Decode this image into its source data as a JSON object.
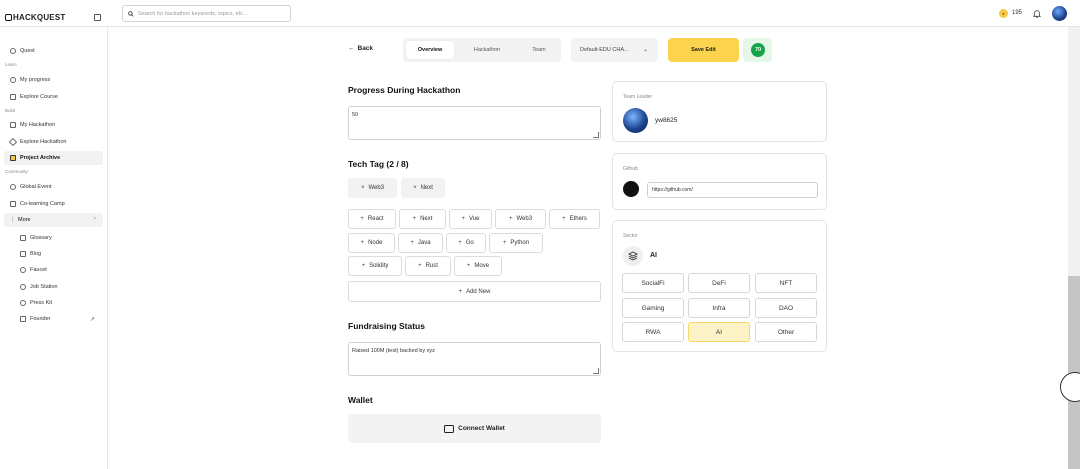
{
  "header": {
    "logo": "HACKQUEST",
    "search_placeholder": "Search for hackathon keywords, topics, etc...",
    "coins": "195"
  },
  "sidebar": {
    "quest": "Quest",
    "sections": {
      "learn": "Learn",
      "build": "Build",
      "community": "Community"
    },
    "learn_items": [
      "My progress",
      "Explore Course"
    ],
    "build_items": [
      "My Hackathon",
      "Explore Hackathon",
      "Project Archive"
    ],
    "community_items": [
      "Global Event",
      "Co-learning Camp",
      "More"
    ],
    "more_items": [
      "Glossary",
      "Blog",
      "Faucet",
      "Job Station",
      "Press Kit",
      "Founder"
    ]
  },
  "toolbar": {
    "back": "Back",
    "tabs": [
      "Overview",
      "Hackathon",
      "Team"
    ],
    "edu_select": "Default-EDU CHA...",
    "save": "Save Edit",
    "score": "70"
  },
  "progress": {
    "title": "Progress During Hackathon",
    "value": "50"
  },
  "tech": {
    "title": "Tech Tag (2 / 8)",
    "selected": [
      "Web3",
      "Next"
    ],
    "options": [
      "React",
      "Next",
      "Vue",
      "Web3",
      "Ethers",
      "Node",
      "Java",
      "Go",
      "Python",
      "Solidity",
      "Rust",
      "Move"
    ],
    "add_new": "Add New"
  },
  "fundraising": {
    "title": "Fundraising Status",
    "value": "Raised 100M (test) backed by xyz"
  },
  "wallet": {
    "title": "Wallet",
    "connect": "Connect Wallet"
  },
  "team_leader": {
    "label": "Team Leader",
    "name": "yw8625"
  },
  "github": {
    "label": "Github",
    "value": "https://github.com/"
  },
  "sector": {
    "label": "Sector",
    "current": "AI",
    "options": [
      "SocialFi",
      "DeFi",
      "NFT",
      "Gaming",
      "Infra",
      "DAO",
      "RWA",
      "AI",
      "Other"
    ],
    "selected": "AI"
  },
  "colors": {
    "accent": "#fcd34d",
    "score_green": "#16a34a",
    "selected_sector": "#fef3c7"
  }
}
